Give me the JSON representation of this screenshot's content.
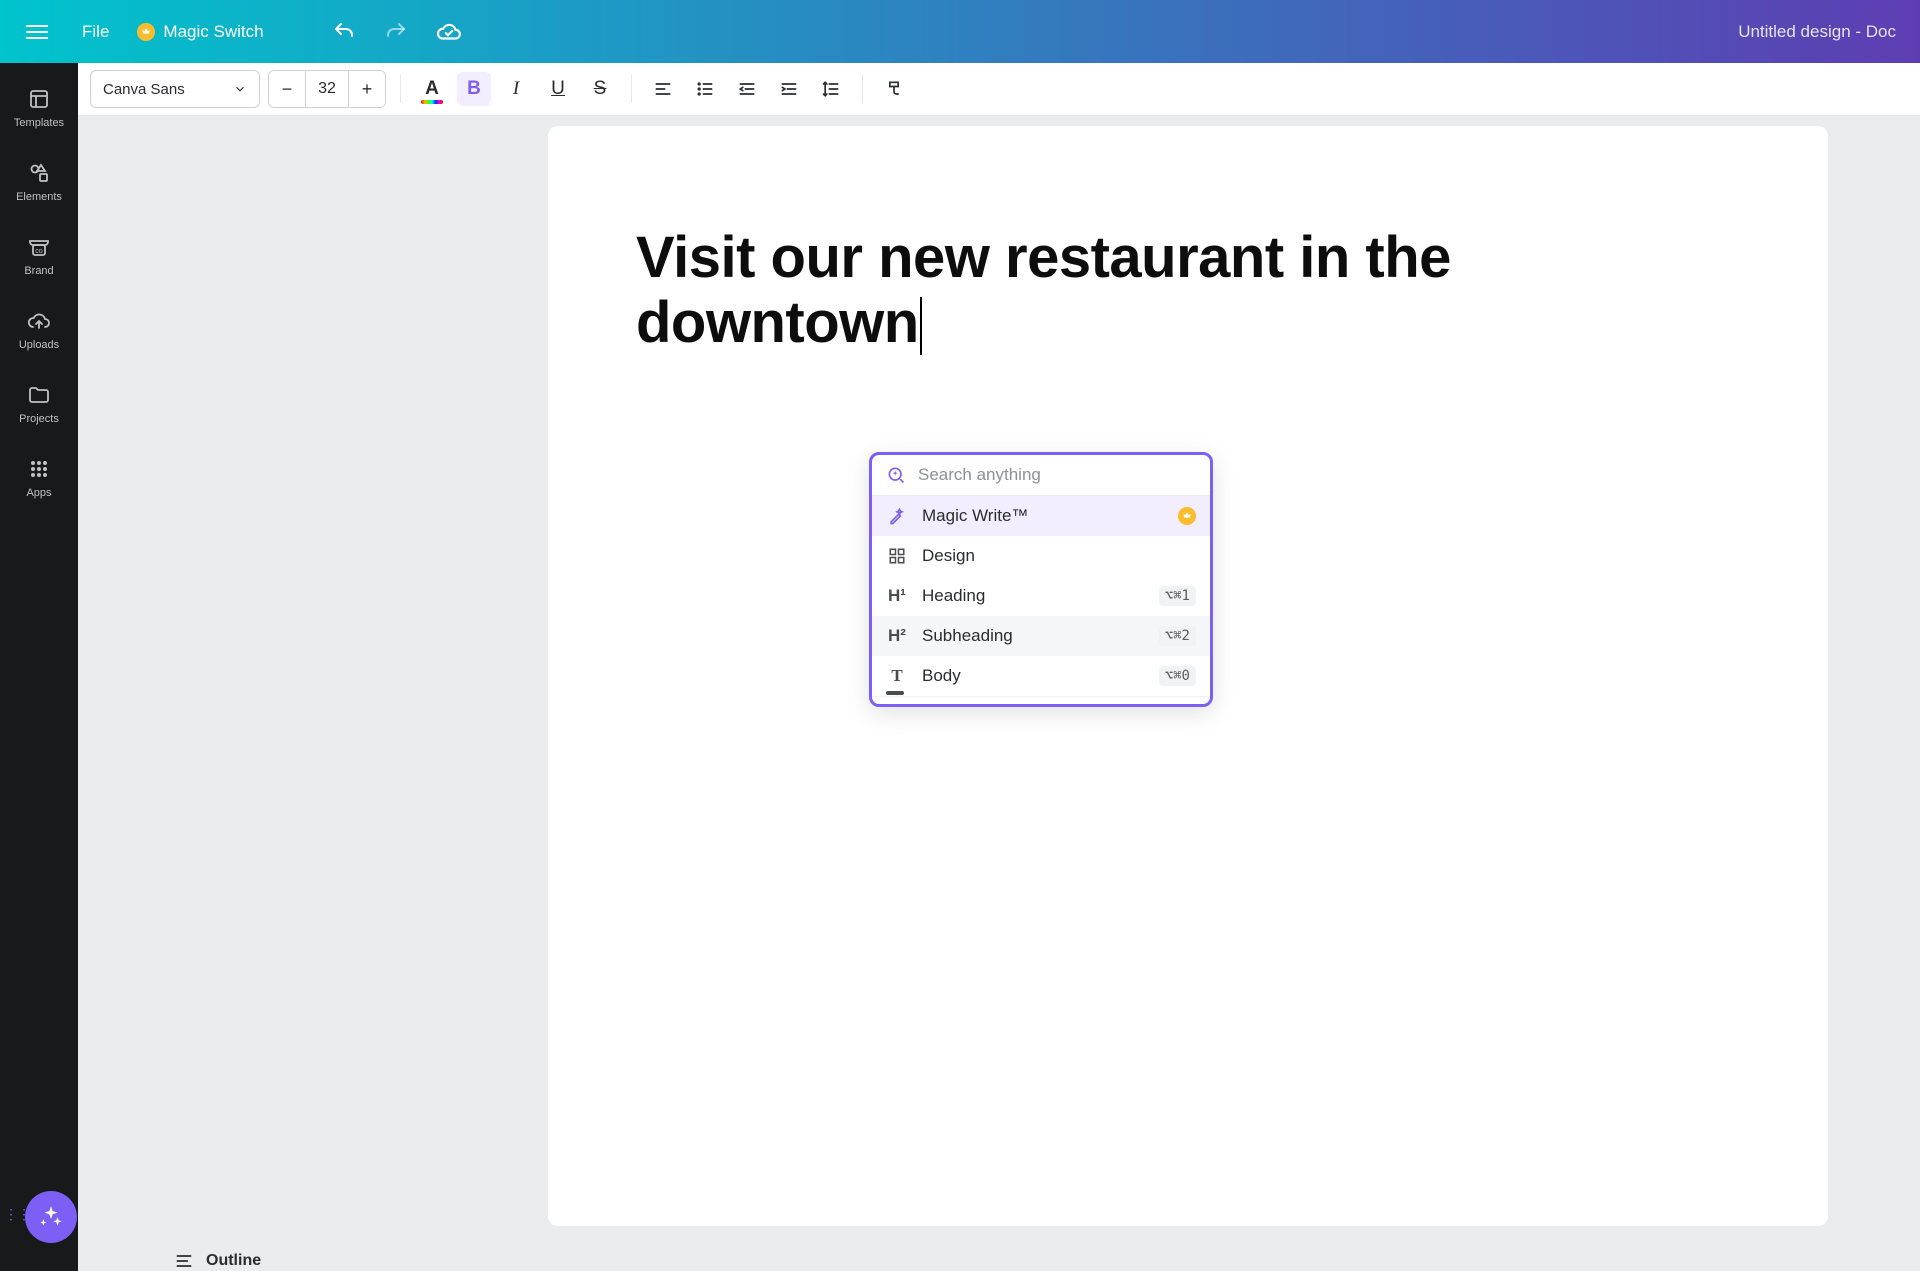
{
  "header": {
    "file_label": "File",
    "magic_switch_label": "Magic Switch",
    "design_title": "Untitled design - Doc"
  },
  "sidebar": {
    "items": [
      {
        "label": "Templates"
      },
      {
        "label": "Elements"
      },
      {
        "label": "Brand"
      },
      {
        "label": "Uploads"
      },
      {
        "label": "Projects"
      },
      {
        "label": "Apps"
      }
    ]
  },
  "toolbar": {
    "font_name": "Canva Sans",
    "font_size": "32",
    "decrease": "−",
    "increase": "+",
    "bold": "B",
    "italic": "I",
    "underline": "U",
    "strike": "S"
  },
  "document": {
    "heading": "Visit our new restaurant in the downtown"
  },
  "popup": {
    "search_placeholder": "Search anything",
    "items": [
      {
        "label": "Magic Write™",
        "icon": "magic-wand",
        "premium": true
      },
      {
        "label": "Design",
        "icon": "grid"
      },
      {
        "label": "Heading",
        "icon": "H¹",
        "shortcut": "⌥⌘1"
      },
      {
        "label": "Subheading",
        "icon": "H²",
        "shortcut": "⌥⌘2"
      },
      {
        "label": "Body",
        "icon": "T",
        "shortcut": "⌥⌘0"
      }
    ]
  },
  "outline": {
    "label": "Outline"
  }
}
